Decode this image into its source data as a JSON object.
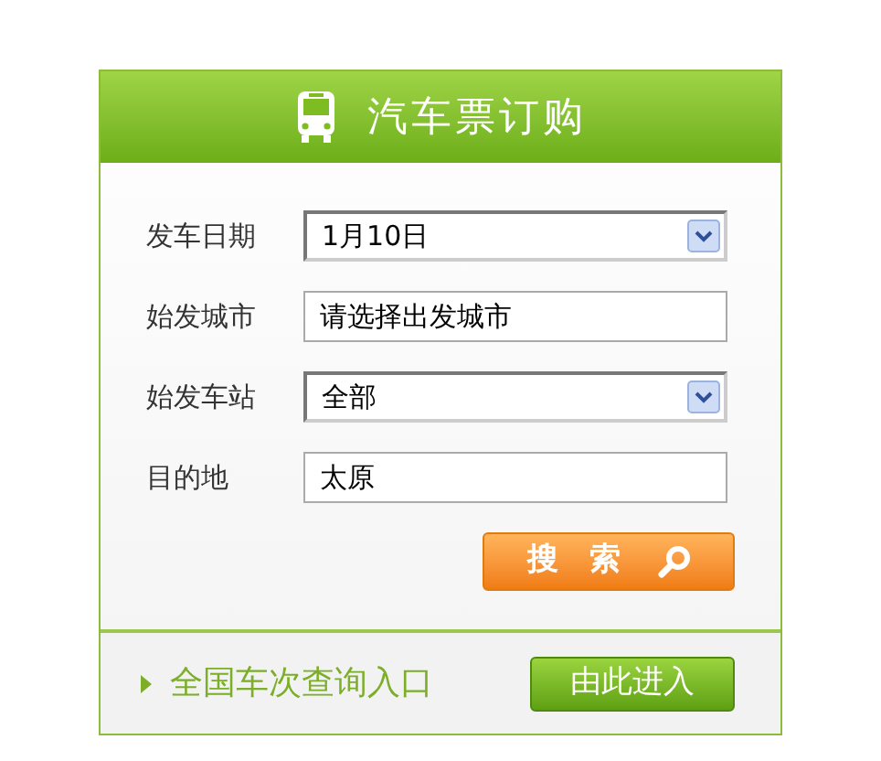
{
  "header": {
    "title": "汽车票订购"
  },
  "fields": [
    {
      "label": "发车日期",
      "kind": "select",
      "value": "1月10日"
    },
    {
      "label": "始发城市",
      "kind": "text",
      "value": "请选择出发城市"
    },
    {
      "label": "始发车站",
      "kind": "select",
      "value": "全部"
    },
    {
      "label": "目的地",
      "kind": "text",
      "value": "太原"
    }
  ],
  "search_button": {
    "label": "搜　索"
  },
  "footer": {
    "link": "全国车次查询入口",
    "button": "由此进入"
  }
}
